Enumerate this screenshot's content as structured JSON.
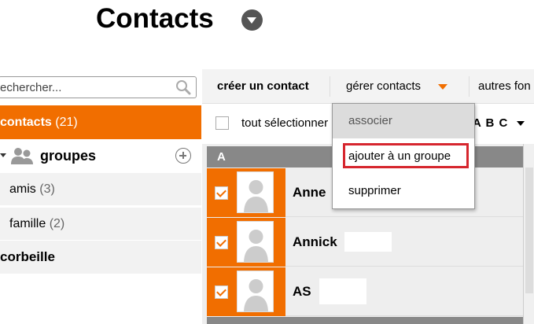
{
  "title": "Contacts",
  "search": {
    "placeholder": "rechercher..."
  },
  "sidebar": {
    "contacts": {
      "label": "contacts",
      "count": "(21)"
    },
    "groups": {
      "label": "groupes"
    },
    "items": [
      {
        "label": "amis",
        "count": "(3)"
      },
      {
        "label": "famille",
        "count": "(2)"
      }
    ],
    "trash": {
      "label": "corbeille"
    }
  },
  "toolbar": {
    "create_label": "créer un contact",
    "manage_label": "gérer contacts",
    "other_label": "autres fon"
  },
  "selectbar": {
    "select_all_label": "tout sélectionner",
    "sort_label": "A B C"
  },
  "list": {
    "letter": "A",
    "rows": [
      {
        "name": "Anne",
        "checked": true
      },
      {
        "name": "Annick",
        "checked": true
      },
      {
        "name": "AS",
        "checked": true
      }
    ]
  },
  "dropdown": {
    "items": [
      "associer",
      "ajouter à un groupe",
      "supprimer"
    ]
  },
  "colors": {
    "accent": "#f16e00",
    "highlight": "#d6262e",
    "header_gray": "#888888"
  }
}
